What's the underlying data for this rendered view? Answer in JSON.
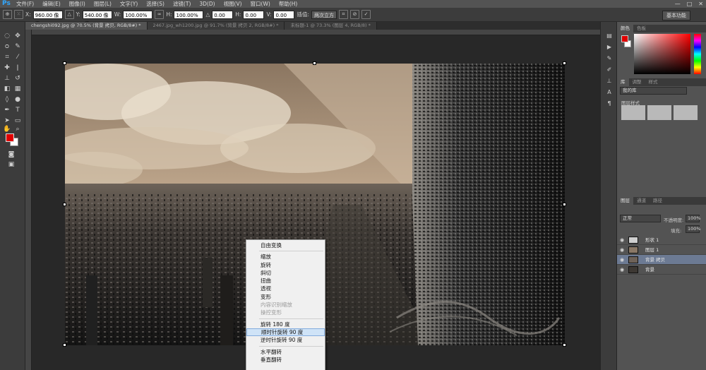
{
  "app": {
    "logo": "Ps"
  },
  "menubar": {
    "items": [
      "文件(F)",
      "编辑(E)",
      "图像(I)",
      "图层(L)",
      "文字(Y)",
      "选择(S)",
      "滤镜(T)",
      "3D(D)",
      "视图(V)",
      "窗口(W)",
      "帮助(H)"
    ],
    "window_controls": [
      "—",
      "□",
      "✕"
    ]
  },
  "options": {
    "x_label": "X:",
    "x_value": "960.00 像素",
    "y_label": "Y:",
    "y_value": "540.00 像素",
    "w_label": "W:",
    "w_value": "100.00%",
    "h_label": "H:",
    "h_value": "100.00%",
    "angle_label": "△",
    "angle_value": "0.00",
    "hskew_label": "H:",
    "hskew_value": "0.00",
    "vskew_label": "V:",
    "vskew_value": "0.00",
    "interp_label": "插值:",
    "interp_value": "两次立方",
    "workspace": "基本功能"
  },
  "tabs": [
    {
      "label": "chengshi092.jpg @ 70.5% (背景 拷贝, RGB/8#) *",
      "active": true
    },
    {
      "label": "2467.jpg_wh1200.jpg @ 91.7% (背景 拷贝 2, RGB/8#) *",
      "active": false
    },
    {
      "label": "未标题-1 @ 73.3% (图层 4, RGB/8) *",
      "active": false
    }
  ],
  "context_menu": {
    "items": [
      {
        "label": "自由变换",
        "state": "normal"
      },
      {
        "sep": true
      },
      {
        "label": "缩放",
        "state": "normal"
      },
      {
        "label": "旋转",
        "state": "normal"
      },
      {
        "label": "斜切",
        "state": "normal"
      },
      {
        "label": "扭曲",
        "state": "normal"
      },
      {
        "label": "透视",
        "state": "normal"
      },
      {
        "label": "变形",
        "state": "normal"
      },
      {
        "label": "内容识别缩放",
        "state": "disabled"
      },
      {
        "label": "操控变形",
        "state": "disabled"
      },
      {
        "sep": true
      },
      {
        "label": "旋转 180 度",
        "state": "normal"
      },
      {
        "label": "顺时针旋转 90 度",
        "state": "highlighted"
      },
      {
        "label": "逆时针旋转 90 度",
        "state": "normal"
      },
      {
        "sep": true
      },
      {
        "label": "水平翻转",
        "state": "normal"
      },
      {
        "label": "垂直翻转",
        "state": "normal"
      }
    ]
  },
  "panels": {
    "color_tabs": [
      "颜色",
      "色板"
    ],
    "library_tabs": [
      "库",
      "调整",
      "样式"
    ],
    "library_select": "我的库",
    "library_style_label": "图层样式",
    "layers_tabs": [
      "图层",
      "通道",
      "路径"
    ],
    "blend_mode": "正常",
    "opacity_label": "不透明度:",
    "opacity_value": "100%",
    "fill_label": "填充:",
    "fill_value": "100%",
    "layers": [
      {
        "name": "形状 1",
        "selected": false
      },
      {
        "name": "图层 1",
        "selected": false
      },
      {
        "name": "背景 拷贝",
        "selected": true
      },
      {
        "name": "背景",
        "selected": false
      }
    ]
  },
  "colors": {
    "foreground": "#e00000",
    "background": "#ffffff",
    "accent": "#31a8ff"
  }
}
